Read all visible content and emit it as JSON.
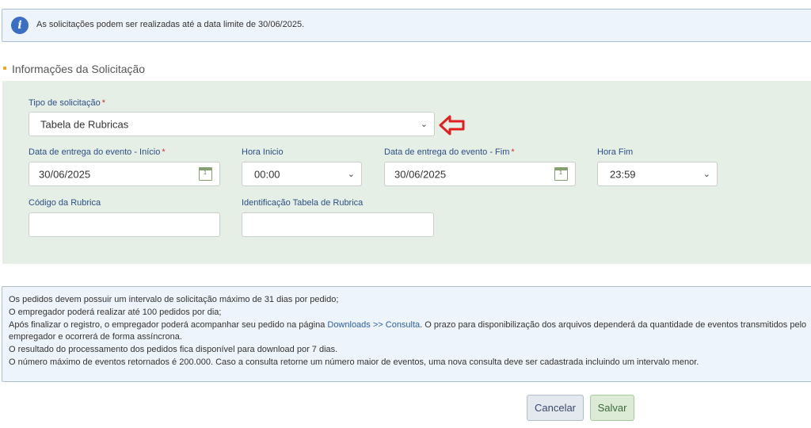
{
  "alert": {
    "icon": "info-icon",
    "icon_glyph": "i",
    "text": "As solicitações podem ser realizadas até a data limite de 30/06/2025."
  },
  "section": {
    "title": "Informações da Solicitação"
  },
  "form": {
    "tipo": {
      "label": "Tipo de solicitação",
      "required": "*",
      "value": "Tabela de Rubricas"
    },
    "data_inicio": {
      "label": "Data de entrega do evento - Início",
      "required": "*",
      "value": "30/06/2025"
    },
    "hora_inicio": {
      "label": "Hora Inicio",
      "value": "00:00"
    },
    "data_fim": {
      "label": "Data de entrega do evento - Fim",
      "required": "*",
      "value": "30/06/2025"
    },
    "hora_fim": {
      "label": "Hora Fim",
      "value": "23:59"
    },
    "codigo_rubrica": {
      "label": "Código da Rubrica",
      "value": ""
    },
    "ident_tabela": {
      "label": "Identificação Tabela de Rubrica",
      "value": ""
    }
  },
  "notes": {
    "line1": "Os pedidos devem possuir um intervalo de solicitação máximo de 31 dias por pedido;",
    "line2": "O empregador poderá realizar até 100 pedidos por dia;",
    "line3_pre": "Após finalizar o registro, o empregador poderá acompanhar seu pedido na página ",
    "line3_link": "Downloads >> Consulta",
    "line3_post": ". O prazo para disponibilização dos arquivos dependerá da quantidade de eventos transmitidos pelo",
    "line4": "empregador e ocorrerá de forma assíncrona.",
    "line5": "O resultado do processamento dos pedidos fica disponível para download por 7 dias.",
    "line6": "O número máximo de eventos retornados é 200.000. Caso a consulta retorne um número maior de eventos, uma nova consulta deve ser cadastrada incluindo um intervalo menor."
  },
  "buttons": {
    "cancel": "Cancelar",
    "save": "Salvar"
  },
  "colors": {
    "panel": "#e5efe5",
    "label": "#2d4f87",
    "required": "#d03030",
    "annotation_arrow": "#e02020",
    "section_bullet": "#f0a52b"
  }
}
